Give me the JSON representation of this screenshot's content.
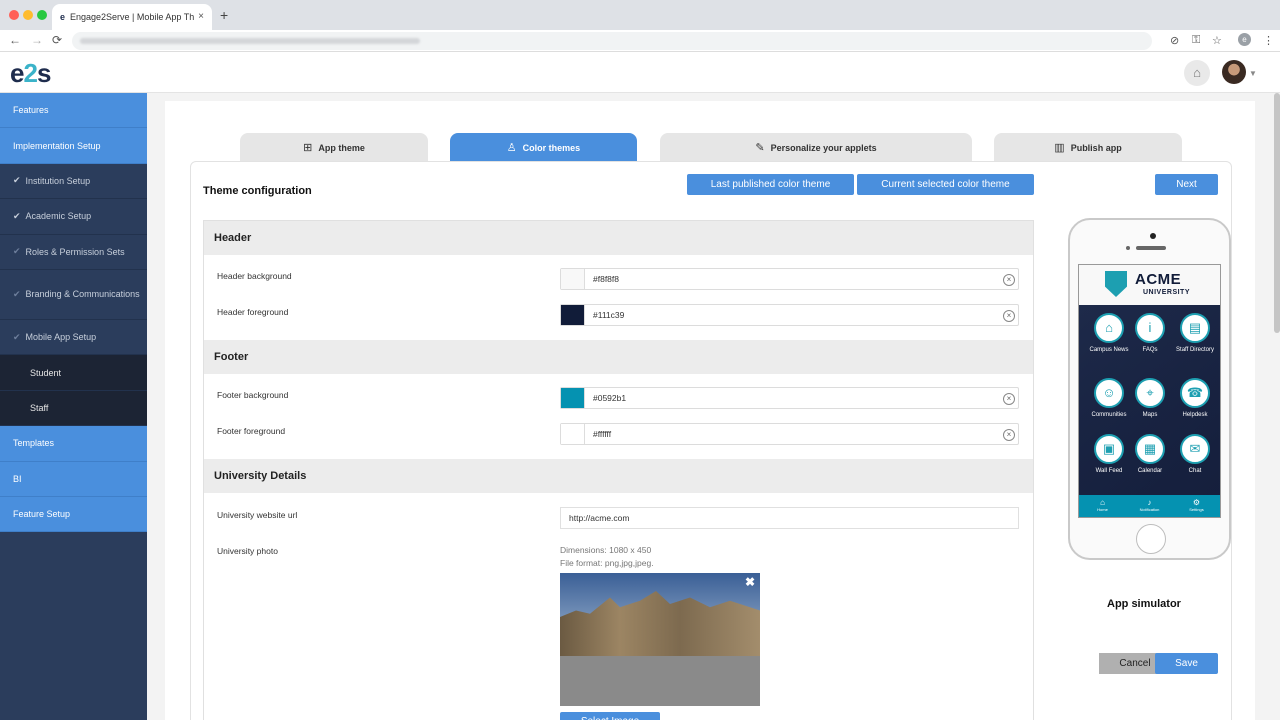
{
  "browser": {
    "tab_title": "Engage2Serve | Mobile App Th",
    "tab_close": "×",
    "new_tab": "+",
    "back": "←",
    "forward": "→",
    "reload": "⟳"
  },
  "app": {
    "logo_e": "e",
    "logo_2": "2",
    "logo_s": "s"
  },
  "sidebar": {
    "items": [
      {
        "label": "Features",
        "style": "blue",
        "check": ""
      },
      {
        "label": "Implementation Setup",
        "style": "blue",
        "check": ""
      },
      {
        "label": "Institution Setup",
        "style": "plain",
        "check": "✔"
      },
      {
        "label": "Academic Setup",
        "style": "plain",
        "check": "✔"
      },
      {
        "label": "Roles & Permission Sets",
        "style": "plain",
        "check": "✔"
      },
      {
        "label": "Branding & Communications",
        "style": "plain",
        "check": "✔"
      },
      {
        "label": "Mobile App Setup",
        "style": "plain",
        "check": "✔"
      },
      {
        "label": "Student",
        "style": "dark",
        "check": ""
      },
      {
        "label": "Staff",
        "style": "dark",
        "check": ""
      },
      {
        "label": "Templates",
        "style": "blue",
        "check": ""
      },
      {
        "label": "BI",
        "style": "blue",
        "check": ""
      },
      {
        "label": "Feature Setup",
        "style": "blue",
        "check": ""
      }
    ]
  },
  "steps": [
    {
      "label": "App theme",
      "icon": "⊞"
    },
    {
      "label": "Color themes",
      "icon": "♙"
    },
    {
      "label": "Personalize your applets",
      "icon": "✎"
    },
    {
      "label": "Publish app",
      "icon": "▥"
    }
  ],
  "theme": {
    "title": "Theme configuration",
    "last_published": "Last published color theme",
    "current_selected": "Current selected color theme",
    "next": "Next"
  },
  "sections": {
    "header": {
      "title": "Header",
      "bg_label": "Header background",
      "bg_value": "#f8f8f8",
      "fg_label": "Header foreground",
      "fg_value": "#111c39"
    },
    "footer": {
      "title": "Footer",
      "bg_label": "Footer background",
      "bg_value": "#0592b1",
      "fg_label": "Footer foreground",
      "fg_value": "#ffffff"
    },
    "university": {
      "title": "University Details",
      "url_label": "University website url",
      "url_value": "http://acme.com",
      "photo_label": "University photo",
      "dimensions": "Dimensions: 1080 x 450",
      "format": "File format: png,jpg,jpeg.",
      "select_image": "Select Image"
    }
  },
  "phone": {
    "brand": "ACME",
    "brand_sub": "UNIVERSITY",
    "apps": [
      {
        "label": "Campus News",
        "icon": "⌂"
      },
      {
        "label": "FAQs",
        "icon": "i"
      },
      {
        "label": "Staff Directory",
        "icon": "▤"
      },
      {
        "label": "Communities",
        "icon": "☺"
      },
      {
        "label": "Maps",
        "icon": "⌖"
      },
      {
        "label": "Helpdesk",
        "icon": "☎"
      },
      {
        "label": "Wall Feed",
        "icon": "▣"
      },
      {
        "label": "Calendar",
        "icon": "▦"
      },
      {
        "label": "Chat",
        "icon": "✉"
      }
    ],
    "footer_items": [
      {
        "label": "Home",
        "icon": "⌂"
      },
      {
        "label": "Notification",
        "icon": "♪"
      },
      {
        "label": "Settings",
        "icon": "⚙"
      }
    ]
  },
  "simulator": {
    "label": "App simulator",
    "cancel": "Cancel",
    "save": "Save"
  },
  "colors": {
    "accent": "#4a8fdd",
    "sidebar": "#2b3d5c",
    "header_bg": "#f8f8f8",
    "header_fg": "#111c39",
    "footer_bg": "#0592b1",
    "footer_fg": "#ffffff"
  }
}
